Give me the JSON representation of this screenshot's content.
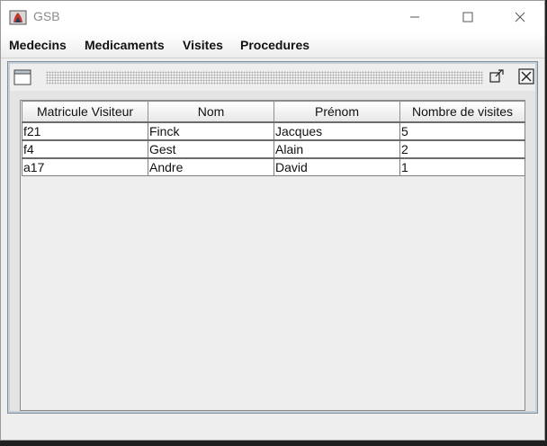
{
  "window": {
    "title": "GSB"
  },
  "menubar": {
    "items": [
      "Medecins",
      "Medicaments",
      "Visites",
      "Procedures"
    ]
  },
  "table": {
    "columns": [
      "Matricule Visiteur",
      "Nom",
      "Prénom",
      "Nombre de visites"
    ],
    "rows": [
      [
        "f21",
        "Finck",
        "Jacques",
        "5"
      ],
      [
        "f4",
        "Gest",
        "Alain",
        "2"
      ],
      [
        "a17",
        "Andre",
        "David",
        "1"
      ]
    ]
  }
}
